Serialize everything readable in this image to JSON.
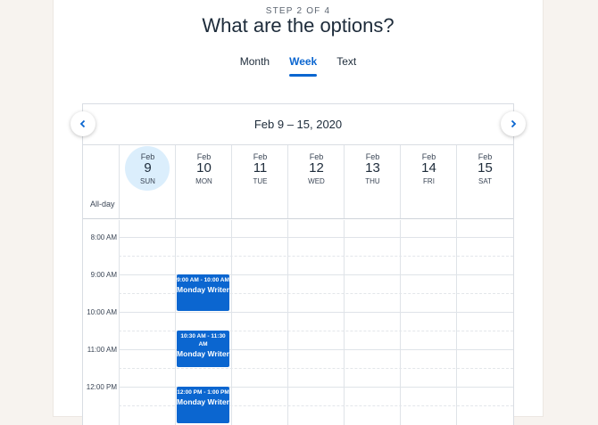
{
  "header": {
    "step": "STEP 2 OF 4",
    "title": "What are the options?"
  },
  "tabs": [
    {
      "label": "Month",
      "active": false
    },
    {
      "label": "Week",
      "active": true
    },
    {
      "label": "Text",
      "active": false
    }
  ],
  "calendar": {
    "range_label": "Feb 9 – 15, 2020",
    "allday_label": "All-day",
    "days": [
      {
        "month": "Feb",
        "num": "9",
        "dow": "SUN",
        "today": true
      },
      {
        "month": "Feb",
        "num": "10",
        "dow": "MON"
      },
      {
        "month": "Feb",
        "num": "11",
        "dow": "TUE"
      },
      {
        "month": "Feb",
        "num": "12",
        "dow": "WED"
      },
      {
        "month": "Feb",
        "num": "13",
        "dow": "THU"
      },
      {
        "month": "Feb",
        "num": "14",
        "dow": "FRI"
      },
      {
        "month": "Feb",
        "num": "15",
        "dow": "SAT"
      }
    ],
    "times": [
      "8:00 AM",
      "9:00 AM",
      "10:00 AM",
      "11:00 AM",
      "12:00 PM"
    ],
    "events": [
      {
        "time": "9:00 AM - 10:00 AM",
        "title": "Monday Writer"
      },
      {
        "time": "10:30 AM - 11:30 AM",
        "title": "Monday Writer"
      },
      {
        "time": "12:00 PM - 1:00 PM",
        "title": "Monday Writer"
      }
    ]
  },
  "colors": {
    "accent": "#0b66d0",
    "today_bg": "#dbeefc",
    "page_bg": "#f7f3ef"
  }
}
